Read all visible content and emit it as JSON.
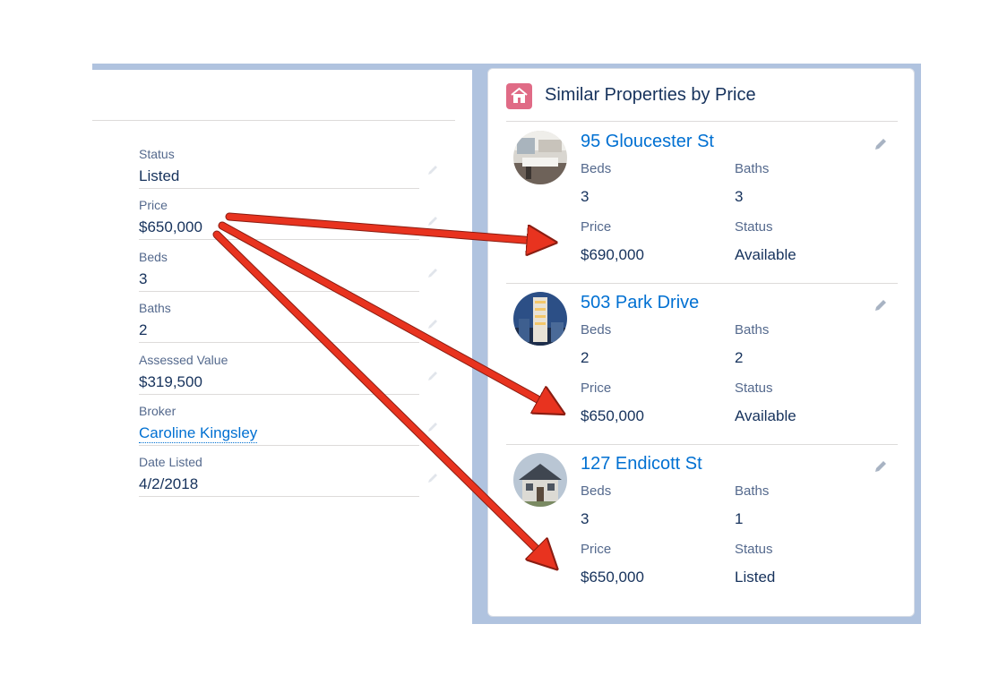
{
  "left_panel": {
    "fields": [
      {
        "label": "Status",
        "value": "Listed"
      },
      {
        "label": "Price",
        "value": "$650,000"
      },
      {
        "label": "Beds",
        "value": "3"
      },
      {
        "label": "Baths",
        "value": "2"
      },
      {
        "label": "Assessed Value",
        "value": "$319,500"
      },
      {
        "label": "Broker",
        "value": "Caroline Kingsley"
      },
      {
        "label": "Date Listed",
        "value": "4/2/2018"
      }
    ]
  },
  "similar": {
    "title": "Similar Properties by Price",
    "icon": "house-icon",
    "properties": [
      {
        "name": "95 Gloucester St",
        "beds_label": "Beds",
        "beds": "3",
        "baths_label": "Baths",
        "baths": "3",
        "price_label": "Price",
        "price": "$690,000",
        "status_label": "Status",
        "status": "Available"
      },
      {
        "name": "503 Park Drive",
        "beds_label": "Beds",
        "beds": "2",
        "baths_label": "Baths",
        "baths": "2",
        "price_label": "Price",
        "price": "$650,000",
        "status_label": "Status",
        "status": "Available"
      },
      {
        "name": "127 Endicott St",
        "beds_label": "Beds",
        "beds": "3",
        "baths_label": "Baths",
        "baths": "1",
        "price_label": "Price",
        "price": "$650,000",
        "status_label": "Status",
        "status": "Listed"
      }
    ]
  },
  "colors": {
    "accent_link": "#0070d2",
    "header_icon": "#e06b86",
    "arrow": "#e8331f",
    "backdrop": "#b0c3df"
  }
}
